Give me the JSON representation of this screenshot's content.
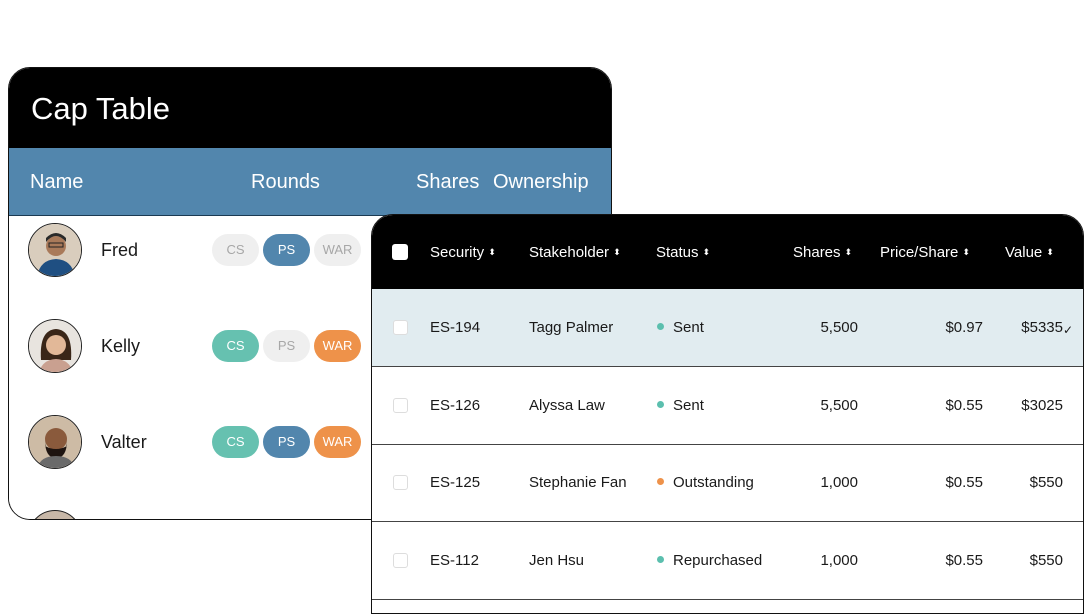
{
  "cap_table": {
    "title": "Cap Table",
    "columns": [
      "Name",
      "Rounds",
      "Shares",
      "Ownership"
    ],
    "rows": [
      {
        "name": "Fred",
        "avatar": "person-avatar",
        "rounds": [
          {
            "label": "CS",
            "active": false
          },
          {
            "label": "PS",
            "active": true,
            "color": "#5286ad"
          },
          {
            "label": "WAR",
            "active": false
          }
        ]
      },
      {
        "name": "Kelly",
        "avatar": "person-avatar",
        "rounds": [
          {
            "label": "CS",
            "active": true,
            "color": "#66c1b0"
          },
          {
            "label": "PS",
            "active": false
          },
          {
            "label": "WAR",
            "active": true,
            "color": "#ee924a"
          }
        ]
      },
      {
        "name": "Valter",
        "avatar": "person-avatar",
        "rounds": [
          {
            "label": "CS",
            "active": true,
            "color": "#66c1b0"
          },
          {
            "label": "PS",
            "active": true,
            "color": "#5286ad"
          },
          {
            "label": "WAR",
            "active": true,
            "color": "#ee924a"
          }
        ]
      }
    ]
  },
  "securities": {
    "columns": [
      "Security",
      "Stakeholder",
      "Status",
      "Shares",
      "Price/Share",
      "Value"
    ],
    "sort_icon": "sort-arrows-icon",
    "rows": [
      {
        "security": "ES-194",
        "stakeholder": "Tagg Palmer",
        "status": "Sent",
        "status_color": "#5bbfae",
        "shares": "5,500",
        "price": "$0.97",
        "value": "$5335",
        "highlighted": true
      },
      {
        "security": "ES-126",
        "stakeholder": "Alyssa Law",
        "status": "Sent",
        "status_color": "#5bbfae",
        "shares": "5,500",
        "price": "$0.55",
        "value": "$3025",
        "highlighted": false
      },
      {
        "security": "ES-125",
        "stakeholder": "Stephanie Fan",
        "status": "Outstanding",
        "status_color": "#ee924a",
        "shares": "1,000",
        "price": "$0.55",
        "value": "$550",
        "highlighted": false
      },
      {
        "security": "ES-112",
        "stakeholder": "Jen Hsu",
        "status": "Repurchased",
        "status_color": "#5bbfae",
        "shares": "1,000",
        "price": "$0.55",
        "value": "$550",
        "highlighted": false
      }
    ]
  },
  "colors": {
    "highlight_row": "#e1ecf0",
    "header_blue": "#5286ad",
    "inactive_pill": "#efefef"
  }
}
